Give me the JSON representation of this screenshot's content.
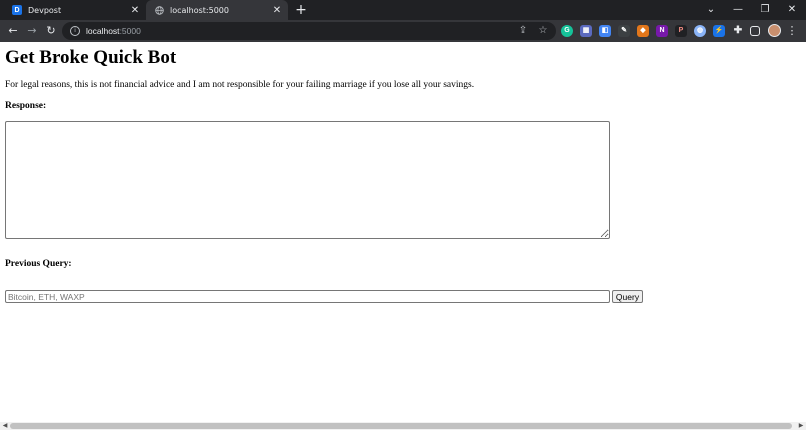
{
  "browser": {
    "tabs": [
      {
        "title": "Devpost",
        "favicon": "devpost-favicon",
        "active": false
      },
      {
        "title": "localhost:5000",
        "favicon": "globe-icon",
        "active": true
      }
    ],
    "address": {
      "host": "localhost",
      "port": ":5000"
    },
    "window_controls": [
      "chevron-down-icon",
      "minimize-icon",
      "restore-icon",
      "close-icon"
    ],
    "extensions": [
      {
        "name": "grammarly-extension-icon",
        "color": "#15c39a",
        "glyph": "G"
      },
      {
        "name": "extension-2-icon",
        "color": "#5b6abf",
        "glyph": "▦"
      },
      {
        "name": "extension-3-icon",
        "color": "#4285f4",
        "glyph": "◧"
      },
      {
        "name": "extension-4-icon",
        "color": "#3c4043",
        "glyph": "✎"
      },
      {
        "name": "metamask-extension-icon",
        "color": "#e2761b",
        "glyph": "🦊"
      },
      {
        "name": "onenote-extension-icon",
        "color": "#7719aa",
        "glyph": "N"
      },
      {
        "name": "extension-7-icon",
        "color": "#202124",
        "glyph": "P"
      },
      {
        "name": "extension-8-icon",
        "color": "#8ab4f8",
        "glyph": "◍"
      },
      {
        "name": "extension-9-icon",
        "color": "#1a73e8",
        "glyph": "⚡"
      }
    ]
  },
  "page": {
    "title": "Get Broke Quick Bot",
    "disclaimer": "For legal reasons, this is not financial advice and I am not responsible for your failing marriage if you lose all your savings.",
    "response_label": "Response:",
    "response_value": "",
    "previous_query_label": "Previous Query:",
    "query_placeholder": "Bitcoin, ETH, WAXP",
    "query_value": "",
    "query_button": "Query"
  }
}
